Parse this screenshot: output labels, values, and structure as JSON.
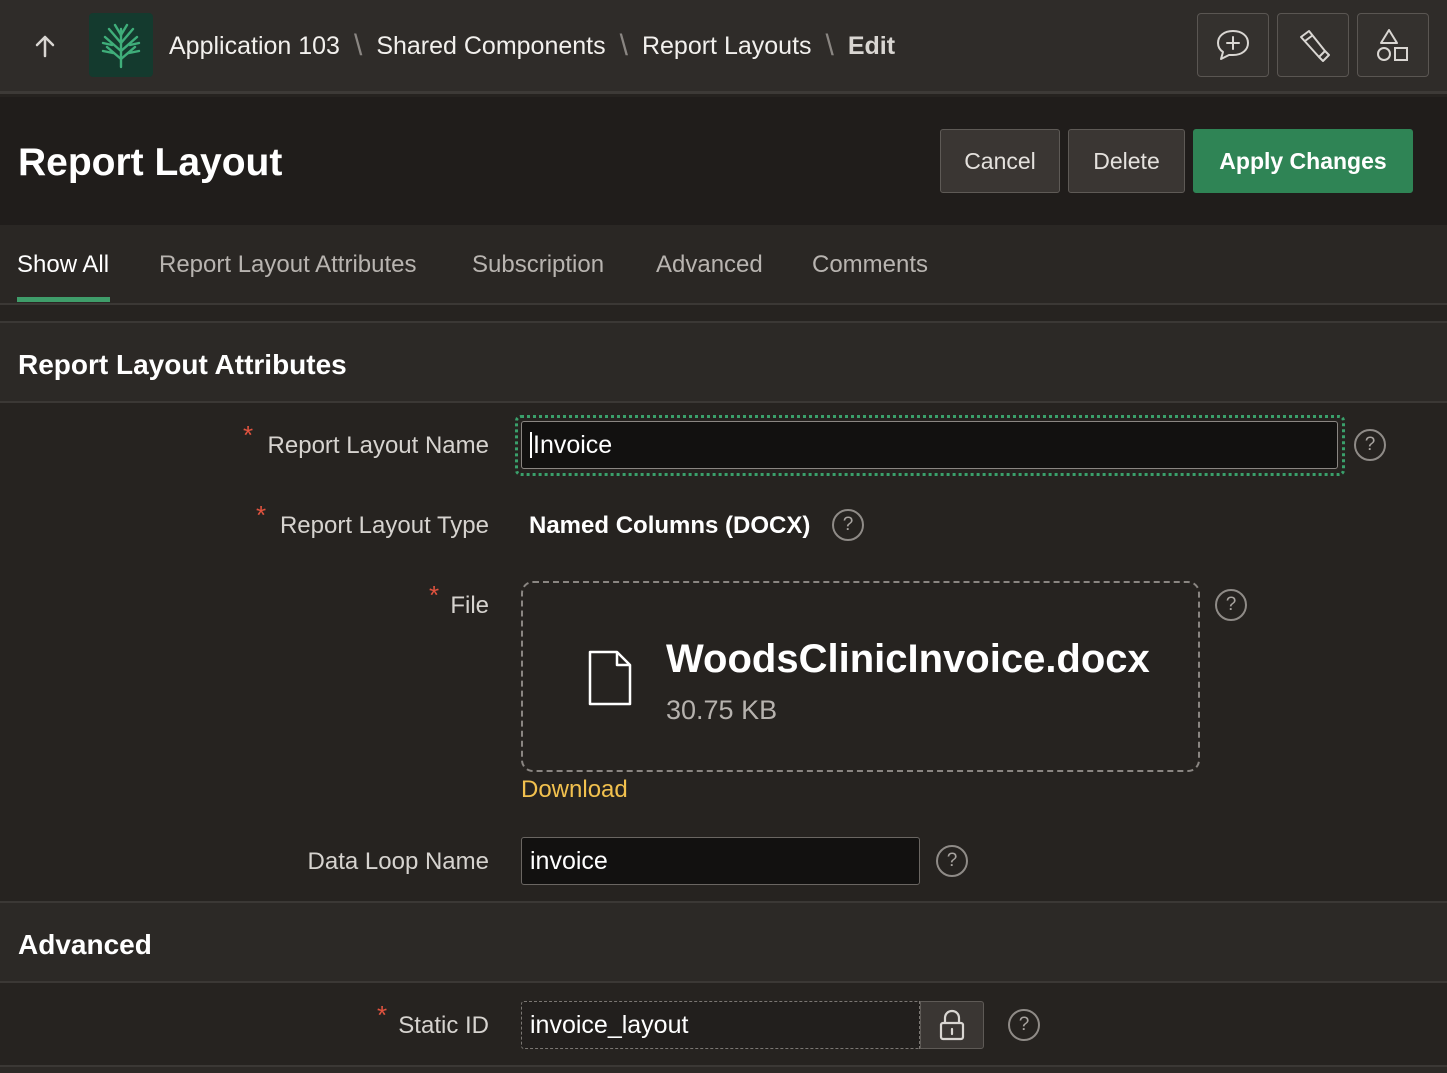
{
  "topbar": {
    "breadcrumb": [
      "Application 103",
      "Shared Components",
      "Report Layouts",
      "Edit"
    ],
    "tools": [
      "comment-add-icon",
      "flashlight-icon",
      "shapes-icon"
    ]
  },
  "header": {
    "title": "Report Layout",
    "cancel_label": "Cancel",
    "delete_label": "Delete",
    "apply_label": "Apply Changes"
  },
  "tabs": [
    "Show All",
    "Report Layout Attributes",
    "Subscription",
    "Advanced",
    "Comments"
  ],
  "active_tab": "Show All",
  "sections": {
    "attributes": {
      "title": "Report Layout Attributes",
      "layout_name_label": "Report Layout Name",
      "layout_name_value": "Invoice",
      "layout_type_label": "Report Layout Type",
      "layout_type_value": "Named Columns (DOCX)",
      "file_label": "File",
      "file_name": "WoodsClinicInvoice.docx",
      "file_size": "30.75 KB",
      "download_label": "Download",
      "data_loop_label": "Data Loop Name",
      "data_loop_value": "invoice"
    },
    "advanced": {
      "title": "Advanced",
      "static_id_label": "Static ID",
      "static_id_value": "invoice_layout"
    }
  },
  "colors": {
    "primary": "#2f8455",
    "required": "#e0533f",
    "link": "#f2c14e",
    "tab_indicator": "#3f9d6a"
  }
}
